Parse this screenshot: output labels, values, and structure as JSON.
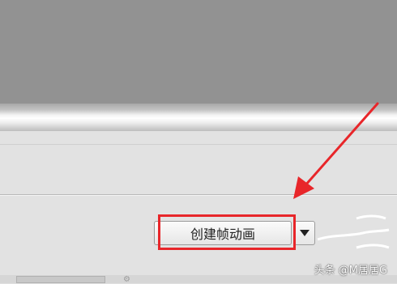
{
  "timeline_panel": {
    "create_frame_animation_button": "创建帧动画",
    "dropdown_icon": "triangle-down-icon"
  },
  "annotation": {
    "color": "#e8262a"
  },
  "watermark": {
    "text": "头条 @M居居G"
  }
}
